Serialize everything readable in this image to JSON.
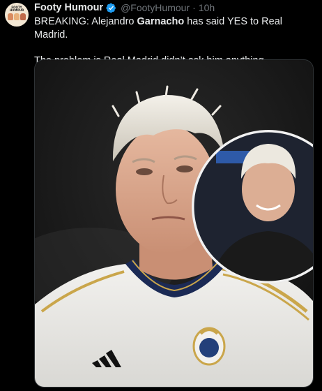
{
  "tweet": {
    "author_name": "Footy Humour",
    "handle": "@FootyHumour",
    "separator": "·",
    "time": "10h",
    "avatar_text": "FOOTY HUMOUR",
    "line1_prefix": "BREAKING: Alejandro ",
    "line1_bold": "Garnacho",
    "line1_suffix": " has said YES to Real Madrid.",
    "line2": "The problem is Real Madrid didn’t ask him anything."
  },
  "colors": {
    "background": "#000000",
    "text": "#e7e9ea",
    "muted": "#71767b",
    "verified": "#1d9bf0"
  },
  "icons": [
    "verified-badge-icon"
  ]
}
